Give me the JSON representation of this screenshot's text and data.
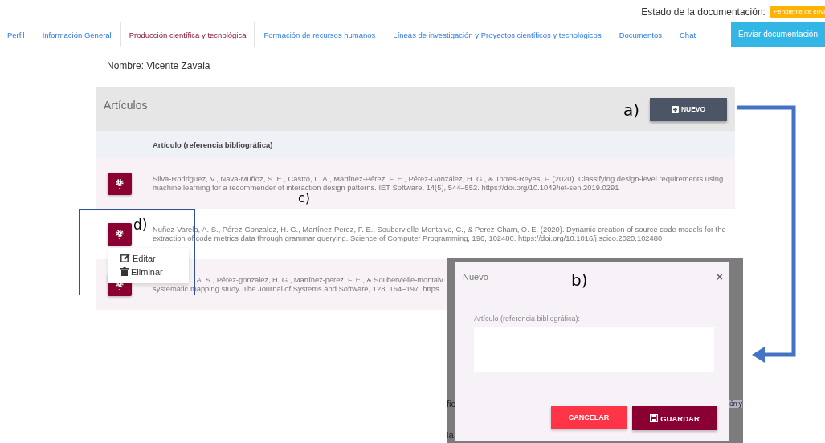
{
  "status": {
    "label": "Estado de la documentación:",
    "badge": "Pendiente de envi"
  },
  "tabs": [
    {
      "label": "Perfil",
      "selected": false
    },
    {
      "label": "Información General",
      "selected": false
    },
    {
      "label": "Producción científica y tecnológica",
      "selected": true
    },
    {
      "label": "Formación de recursos humanos",
      "selected": false
    },
    {
      "label": "Líneas de investigación y Proyectos científicos y tecnológicos",
      "selected": false
    },
    {
      "label": "Documentos",
      "selected": false
    },
    {
      "label": "Chat",
      "selected": false
    }
  ],
  "send_button": "Enviar documentación",
  "name": "Nombre: Vicente Zavala",
  "panel": {
    "title": "Artículos",
    "new_button": "NUEVO",
    "column": "Artículo (referencia bibliográfica)",
    "rows": [
      {
        "lines": [
          {
            "text": "Silva-Rodriguez, V., Nava-Muñoz, S. E., Castro, L. A., Martínez-Pérez, F. E., Pérez-González, H. G., & Torres-Reyes, F. (2020). Classifying design-level requirements using",
            "indent": false
          },
          {
            "text": "machine learning for a recommender of interaction design patterns. IET Software, 14(5), 544–552. https://doi.org/10.1049/iet-sen.2019.0291",
            "indent": false
          }
        ]
      },
      {
        "lines": [
          {
            "text": "Nuñez-Varela, A. S., Pérez-Gonzalez, H. G., Martínez-Perez, F. E., Soubervielle-Montalvo, C., & Perez-Cham, O. E. (2020). Dynamic creation of source code models for the",
            "indent": false
          },
          {
            "text": "extraction of code metrics data through grammar querying. Science of Computer Programming, 196, 102480. https://doi.org/10.1016/j.scico.2020.102480",
            "indent": false
          }
        ]
      },
      {
        "lines": [
          {
            "text": ", A. S., Pérez-gonzalez, H. G., Martínez-perez, F. E., & Soubervielle-montalv",
            "indent": true
          },
          {
            "text": "systematic mapping study. The Journal of Systems and Software, 128, 164–197. https",
            "indent": false
          }
        ]
      }
    ]
  },
  "menu": [
    "Editar",
    "Eliminar"
  ],
  "modal": {
    "title": "Nuevo",
    "close": "×",
    "label": "Artículo (referencia bibliográfica):",
    "cancel": "CANCELAR",
    "save": "GUARDAR",
    "fragments": [
      "fic",
      "ón y",
      "la"
    ]
  },
  "annotations": [
    "a)",
    "b)",
    "c)",
    "d)"
  ]
}
